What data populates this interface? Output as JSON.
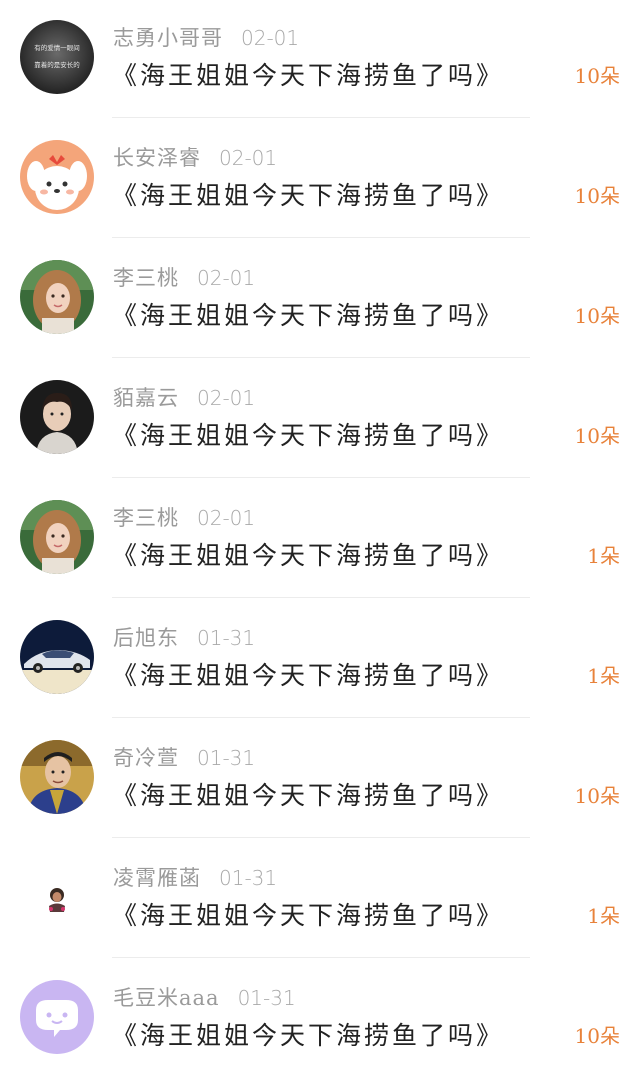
{
  "accent_color": "#e8823a",
  "message_text": "《海王姐姐今天下海捞鱼了吗》",
  "items": [
    {
      "name": "志勇小哥哥",
      "date": "02-01",
      "message": "《海王姐姐今天下海捞鱼了吗》",
      "count": "10朵",
      "avatar": "grayscale-quote-avatar"
    },
    {
      "name": "长安泽睿",
      "date": "02-01",
      "message": "《海王姐姐今天下海捞鱼了吗》",
      "count": "10朵",
      "avatar": "cartoon-dog-avatar"
    },
    {
      "name": "李三桃",
      "date": "02-01",
      "message": "《海王姐姐今天下海捞鱼了吗》",
      "count": "10朵",
      "avatar": "woman-photo-avatar"
    },
    {
      "name": "貊嘉云",
      "date": "02-01",
      "message": "《海王姐姐今天下海捞鱼了吗》",
      "count": "10朵",
      "avatar": "man-photo-avatar"
    },
    {
      "name": "李三桃",
      "date": "02-01",
      "message": "《海王姐姐今天下海捞鱼了吗》",
      "count": "1朵",
      "avatar": "woman-photo-avatar"
    },
    {
      "name": "后旭东",
      "date": "01-31",
      "message": "《海王姐姐今天下海捞鱼了吗》",
      "count": "1朵",
      "avatar": "car-photo-avatar"
    },
    {
      "name": "奇冷萱",
      "date": "01-31",
      "message": "《海王姐姐今天下海捞鱼了吗》",
      "count": "10朵",
      "avatar": "costume-man-avatar"
    },
    {
      "name": "凌霄雁菡",
      "date": "01-31",
      "message": "《海王姐姐今天下海捞鱼了吗》",
      "count": "1朵",
      "avatar": "small-figure-avatar"
    },
    {
      "name": "毛豆米aaa",
      "date": "01-31",
      "message": "《海王姐姐今天下海捞鱼了吗》",
      "count": "10朵",
      "avatar": "chat-bubble-avatar"
    }
  ],
  "avatar_quote_text": [
    "有的爱情一眼间",
    "靠着的是安长的"
  ]
}
